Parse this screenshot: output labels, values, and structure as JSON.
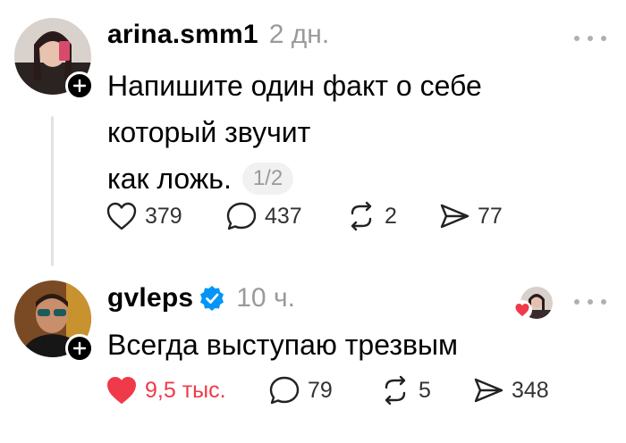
{
  "posts": [
    {
      "username": "arina.smm1",
      "time": "2 дн.",
      "text_lines": [
        "Напишите один факт о себе",
        "который звучит",
        "как ложь."
      ],
      "page_indicator": "1/2",
      "actions": {
        "likes": "379",
        "comments": "437",
        "reposts": "2",
        "shares": "77"
      },
      "liked": false
    },
    {
      "username": "gvleps",
      "verified": true,
      "time": "10 ч.",
      "text_lines": [
        "Всегда выступаю трезвым"
      ],
      "actions": {
        "likes": "9,5 тыс.",
        "comments": "79",
        "reposts": "5",
        "shares": "348"
      },
      "liked": true
    }
  ],
  "colors": {
    "like_active": "#ef3a49",
    "verified": "#0095f6",
    "muted": "#9a9a9a"
  },
  "icons": [
    "heart-icon",
    "comment-icon",
    "repost-icon",
    "share-icon",
    "more-icon",
    "plus-icon",
    "verified-icon"
  ]
}
